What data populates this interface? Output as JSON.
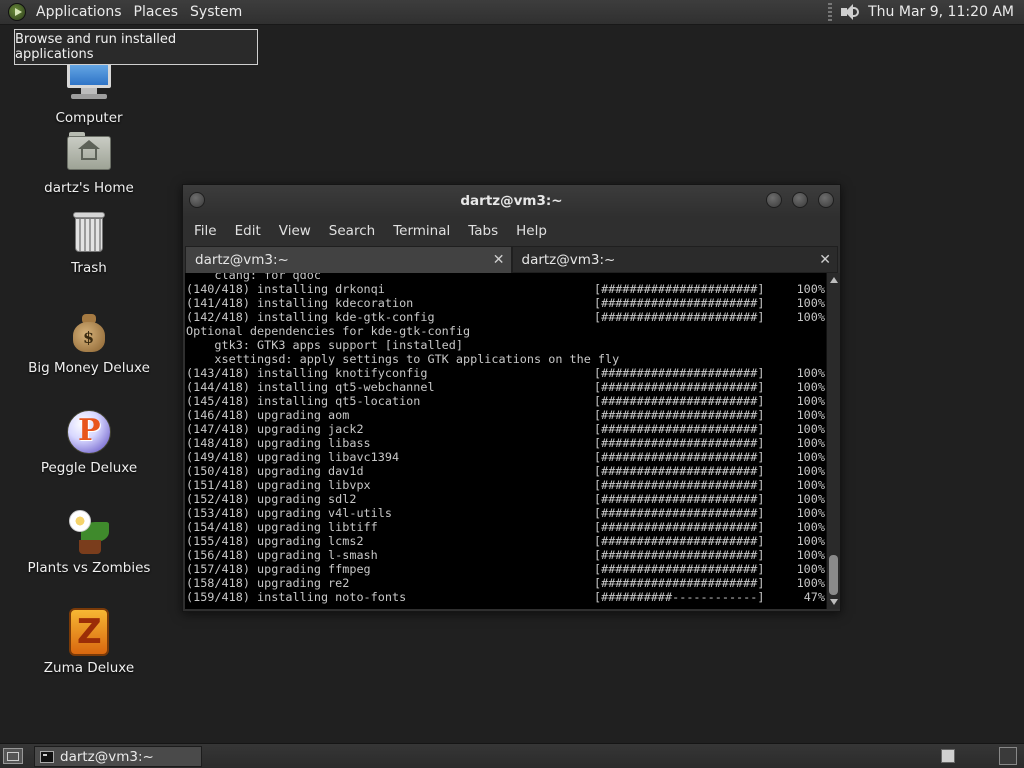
{
  "top_panel": {
    "menus": [
      "Applications",
      "Places",
      "System"
    ],
    "clock": "Thu Mar  9, 11:20 AM"
  },
  "tooltip": "Browse and run installed applications",
  "desktop_icons": [
    {
      "label": "Computer",
      "icon": "computer-icon"
    },
    {
      "label": "dartz's Home",
      "icon": "home-folder-icon"
    },
    {
      "label": "Trash",
      "icon": "trash-icon"
    },
    {
      "label": "Big Money Deluxe",
      "icon": "money-bag-icon"
    },
    {
      "label": "Peggle Deluxe",
      "icon": "peggle-icon"
    },
    {
      "label": "Plants vs Zombies",
      "icon": "plants-vs-zombies-icon"
    },
    {
      "label": "Zuma Deluxe",
      "icon": "zuma-icon"
    }
  ],
  "terminal": {
    "title": "dartz@vm3:~",
    "menu": [
      "File",
      "Edit",
      "View",
      "Search",
      "Terminal",
      "Tabs",
      "Help"
    ],
    "tabs": [
      {
        "label": "dartz@vm3:~",
        "active": true
      },
      {
        "label": "dartz@vm3:~",
        "active": false
      }
    ],
    "lines": [
      {
        "text": "    clang: for qdoc"
      },
      {
        "text": "(140/418) installing drkonqi",
        "bar": "[######################]",
        "pct": "100%"
      },
      {
        "text": "(141/418) installing kdecoration",
        "bar": "[######################]",
        "pct": "100%"
      },
      {
        "text": "(142/418) installing kde-gtk-config",
        "bar": "[######################]",
        "pct": "100%"
      },
      {
        "text": "Optional dependencies for kde-gtk-config"
      },
      {
        "text": "    gtk3: GTK3 apps support [installed]"
      },
      {
        "text": "    xsettingsd: apply settings to GTK applications on the fly"
      },
      {
        "text": "(143/418) installing knotifyconfig",
        "bar": "[######################]",
        "pct": "100%"
      },
      {
        "text": "(144/418) installing qt5-webchannel",
        "bar": "[######################]",
        "pct": "100%"
      },
      {
        "text": "(145/418) installing qt5-location",
        "bar": "[######################]",
        "pct": "100%"
      },
      {
        "text": "(146/418) upgrading aom",
        "bar": "[######################]",
        "pct": "100%"
      },
      {
        "text": "(147/418) upgrading jack2",
        "bar": "[######################]",
        "pct": "100%"
      },
      {
        "text": "(148/418) upgrading libass",
        "bar": "[######################]",
        "pct": "100%"
      },
      {
        "text": "(149/418) upgrading libavc1394",
        "bar": "[######################]",
        "pct": "100%"
      },
      {
        "text": "(150/418) upgrading dav1d",
        "bar": "[######################]",
        "pct": "100%"
      },
      {
        "text": "(151/418) upgrading libvpx",
        "bar": "[######################]",
        "pct": "100%"
      },
      {
        "text": "(152/418) upgrading sdl2",
        "bar": "[######################]",
        "pct": "100%"
      },
      {
        "text": "(153/418) upgrading v4l-utils",
        "bar": "[######################]",
        "pct": "100%"
      },
      {
        "text": "(154/418) upgrading libtiff",
        "bar": "[######################]",
        "pct": "100%"
      },
      {
        "text": "(155/418) upgrading lcms2",
        "bar": "[######################]",
        "pct": "100%"
      },
      {
        "text": "(156/418) upgrading l-smash",
        "bar": "[######################]",
        "pct": "100%"
      },
      {
        "text": "(157/418) upgrading ffmpeg",
        "bar": "[######################]",
        "pct": "100%"
      },
      {
        "text": "(158/418) upgrading re2",
        "bar": "[######################]",
        "pct": "100%"
      },
      {
        "text": "(159/418) installing noto-fonts",
        "bar": "[##########------------]",
        "pct": "47%"
      }
    ]
  },
  "taskbar": {
    "window_button": "dartz@vm3:~"
  }
}
